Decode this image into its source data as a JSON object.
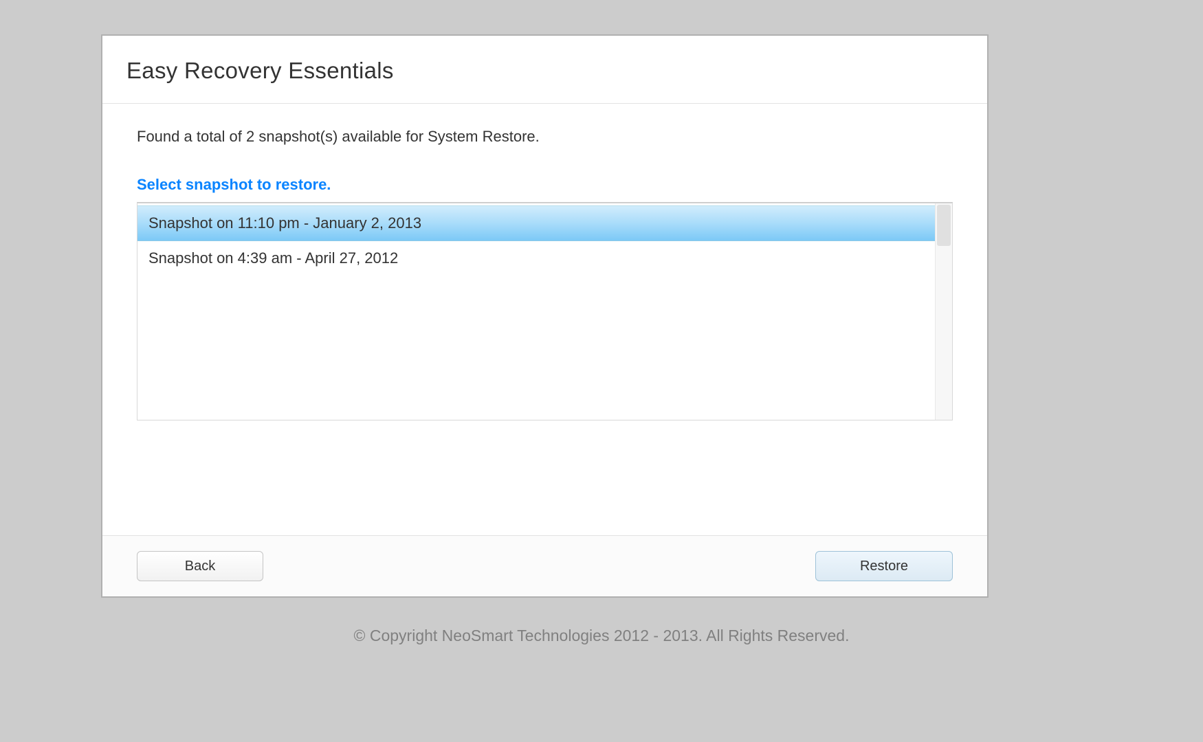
{
  "header": {
    "title": "Easy Recovery Essentials"
  },
  "content": {
    "status": "Found a total of 2 snapshot(s) available for System Restore.",
    "instruction": "Select snapshot to restore.",
    "snapshots": [
      {
        "label": "Snapshot on 11:10 pm - January 2, 2013",
        "selected": true
      },
      {
        "label": "Snapshot on 4:39 am - April 27, 2012",
        "selected": false
      }
    ]
  },
  "footer": {
    "back_label": "Back",
    "restore_label": "Restore"
  },
  "copyright": "© Copyright NeoSmart Technologies 2012 - 2013. All Rights Reserved."
}
